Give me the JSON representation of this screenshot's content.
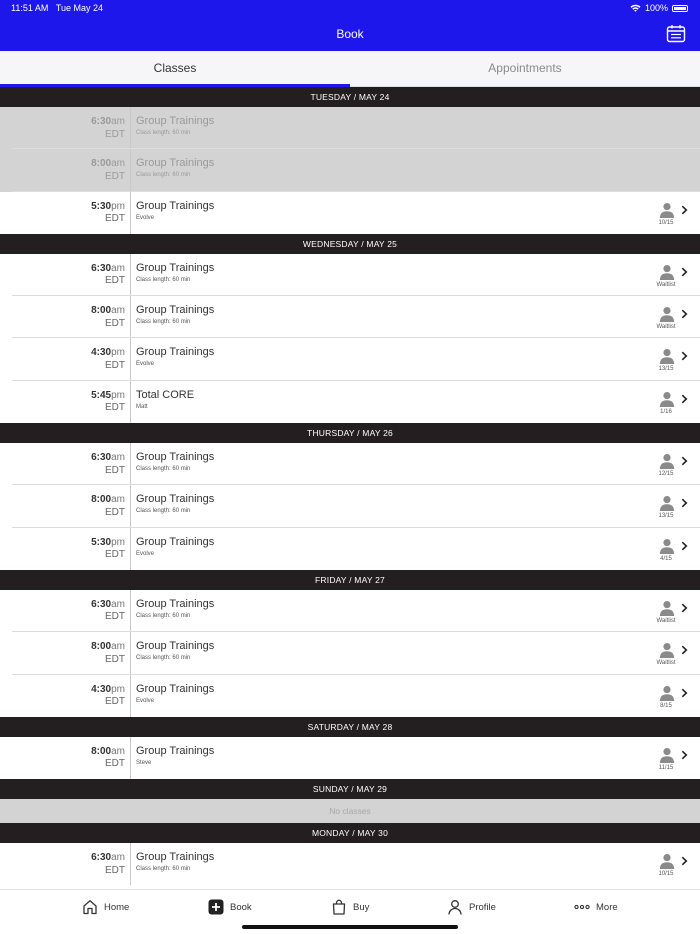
{
  "status": {
    "time": "11:51 AM",
    "date": "Tue May 24",
    "battery": "100%"
  },
  "header": {
    "title": "Book"
  },
  "tabs": [
    {
      "label": "Classes",
      "active": true
    },
    {
      "label": "Appointments",
      "active": false
    }
  ],
  "days": [
    {
      "label": "TUESDAY / MAY 24",
      "classes": [
        {
          "time": "6:30",
          "ampm": "am",
          "tz": "EDT",
          "name": "Group Trainings",
          "sub": "Class length: 60 min",
          "spots": "",
          "past": true
        },
        {
          "time": "8:00",
          "ampm": "am",
          "tz": "EDT",
          "name": "Group Trainings",
          "sub": "Class length: 60 min",
          "spots": "",
          "past": true
        },
        {
          "time": "5:30",
          "ampm": "pm",
          "tz": "EDT",
          "name": "Group Trainings",
          "sub": "Evolve",
          "spots": "10/15",
          "past": false
        }
      ]
    },
    {
      "label": "WEDNESDAY / MAY 25",
      "classes": [
        {
          "time": "6:30",
          "ampm": "am",
          "tz": "EDT",
          "name": "Group Trainings",
          "sub": "Class length: 60 min",
          "spots": "Waitlist",
          "past": false
        },
        {
          "time": "8:00",
          "ampm": "am",
          "tz": "EDT",
          "name": "Group Trainings",
          "sub": "Class length: 60 min",
          "spots": "Waitlist",
          "past": false
        },
        {
          "time": "4:30",
          "ampm": "pm",
          "tz": "EDT",
          "name": "Group Trainings",
          "sub": "Evolve",
          "spots": "13/15",
          "past": false
        },
        {
          "time": "5:45",
          "ampm": "pm",
          "tz": "EDT",
          "name": "Total CORE",
          "sub": "Matt",
          "spots": "1/16",
          "past": false
        }
      ]
    },
    {
      "label": "THURSDAY / MAY 26",
      "classes": [
        {
          "time": "6:30",
          "ampm": "am",
          "tz": "EDT",
          "name": "Group Trainings",
          "sub": "Class length: 60 min",
          "spots": "12/15",
          "past": false
        },
        {
          "time": "8:00",
          "ampm": "am",
          "tz": "EDT",
          "name": "Group Trainings",
          "sub": "Class length: 60 min",
          "spots": "13/15",
          "past": false
        },
        {
          "time": "5:30",
          "ampm": "pm",
          "tz": "EDT",
          "name": "Group Trainings",
          "sub": "Evolve",
          "spots": "4/15",
          "past": false
        }
      ]
    },
    {
      "label": "FRIDAY / MAY 27",
      "classes": [
        {
          "time": "6:30",
          "ampm": "am",
          "tz": "EDT",
          "name": "Group Trainings",
          "sub": "Class length: 60 min",
          "spots": "Waitlist",
          "past": false
        },
        {
          "time": "8:00",
          "ampm": "am",
          "tz": "EDT",
          "name": "Group Trainings",
          "sub": "Class length: 60 min",
          "spots": "Waitlist",
          "past": false
        },
        {
          "time": "4:30",
          "ampm": "pm",
          "tz": "EDT",
          "name": "Group Trainings",
          "sub": "Evolve",
          "spots": "8/15",
          "past": false
        }
      ]
    },
    {
      "label": "SATURDAY / MAY 28",
      "classes": [
        {
          "time": "8:00",
          "ampm": "am",
          "tz": "EDT",
          "name": "Group Trainings",
          "sub": "Steve",
          "spots": "11/15",
          "past": false
        }
      ]
    },
    {
      "label": "SUNDAY / MAY 29",
      "classes": [],
      "empty_text": "No classes"
    },
    {
      "label": "MONDAY / MAY 30",
      "classes": [
        {
          "time": "6:30",
          "ampm": "am",
          "tz": "EDT",
          "name": "Group Trainings",
          "sub": "Class length: 60 min",
          "spots": "10/15",
          "past": false
        }
      ]
    }
  ],
  "nav": [
    {
      "label": "Home",
      "icon": "home-icon"
    },
    {
      "label": "Book",
      "icon": "book-plus-icon"
    },
    {
      "label": "Buy",
      "icon": "shopping-bag-icon"
    },
    {
      "label": "Profile",
      "icon": "profile-icon"
    },
    {
      "label": "More",
      "icon": "more-dots-icon"
    }
  ],
  "colors": {
    "brand": "#1e17ec",
    "day_header": "#231f20",
    "past_row": "#d3d3d3"
  }
}
